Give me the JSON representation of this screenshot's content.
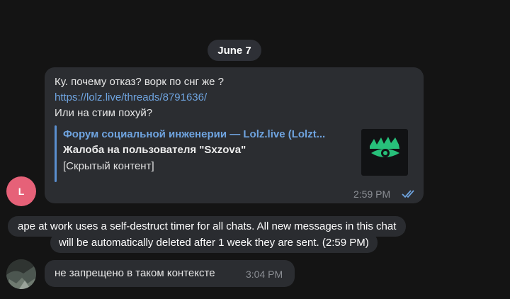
{
  "date_separator": "June 7",
  "message_1": {
    "avatar_letter": "L",
    "lines": [
      "Ку. почему отказ? ворк по снг же ?",
      "https://lolz.live/threads/8791636/",
      "Или на стим похуй?"
    ],
    "link_preview": {
      "site_name": "Форум социальной инженерии —  Lolz.live (Lolzt...",
      "title": "Жалоба на пользователя \"Sxzova\"",
      "description": "[Скрытый контент]",
      "thumb_icon": "lolz-logo-icon"
    },
    "time": "2:59 PM",
    "status_icon": "double-check-read-icon",
    "colors": {
      "avatar": "#e66178",
      "link": "#6fa4e0",
      "check": "#6fa4e0"
    }
  },
  "service_message": {
    "line1": "ape at work uses a self-destruct timer for all chats. All new messages in this chat",
    "line2": "will be automatically deleted after 1 week they are sent. (2:59 PM)"
  },
  "message_2": {
    "text": "не запрещено в таком контексте",
    "time": "3:04 PM",
    "avatar_icon": "user-photo-avatar"
  }
}
